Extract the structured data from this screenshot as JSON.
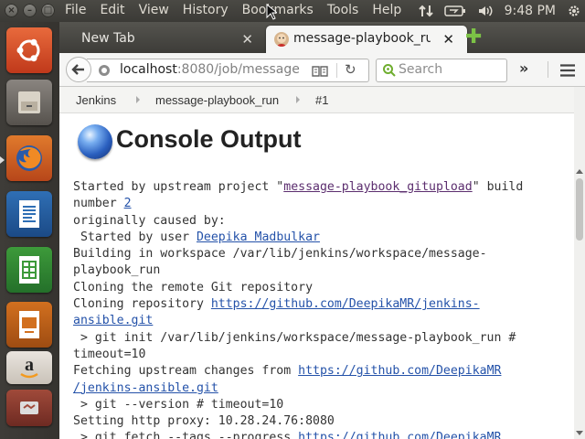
{
  "top_panel": {
    "menu": [
      "File",
      "Edit",
      "View",
      "History",
      "Bookmarks",
      "Tools",
      "Help"
    ],
    "clock": "9:48 PM",
    "icons": [
      "network-updown-icon",
      "battery-icon",
      "volume-icon",
      "gear-icon"
    ]
  },
  "launcher": {
    "items": [
      "ubuntu-dash-icon",
      "files-icon",
      "firefox-icon",
      "writer-icon",
      "calc-icon",
      "impress-icon",
      "amazon-icon",
      "system-settings-icon"
    ]
  },
  "browser": {
    "tabs": [
      {
        "title": "New Tab",
        "active": false
      },
      {
        "title": "message-playbook_run #1",
        "active": true
      }
    ],
    "url": {
      "host": "localhost",
      "rest": ":8080/job/message"
    },
    "search_placeholder": "Search"
  },
  "page": {
    "breadcrumbs": [
      "Jenkins",
      "message-playbook_run",
      "#1"
    ],
    "title": "Console Output",
    "console": {
      "started_prefix": "Started by upstream project \"",
      "upstream_project": "message-playbook_gitupload",
      "started_mid": "\" build",
      "number_prefix": "number ",
      "build_number": "2",
      "caused_by": "originally caused by:",
      "started_by_user_prefix": " Started by user ",
      "user": "Deepika Madbulkar",
      "workspace_1": "Building in workspace /var/lib/jenkins/workspace/message-",
      "workspace_2": "playbook_run",
      "cloning_remote": "Cloning the remote Git repository",
      "cloning_repo_prefix": "Cloning repository ",
      "repo_url_1": "https://github.com/DeepikaMR/jenkins-",
      "repo_url_2": "ansible.git",
      "git_init_1": " > git init /var/lib/jenkins/workspace/message-playbook_run #",
      "git_init_2": "timeout=10",
      "fetching_prefix": "Fetching upstream changes from ",
      "fetch_url_1": "https://github.com/DeepikaMR",
      "fetch_url_2": "/jenkins-ansible.git",
      "git_version": " > git --version # timeout=10",
      "proxy": "Setting http proxy: 10.28.24.76:8080",
      "git_fetch_prefix": " > git fetch --tags --progress ",
      "git_fetch_url": "https://github.com/DeepikaMR"
    }
  }
}
